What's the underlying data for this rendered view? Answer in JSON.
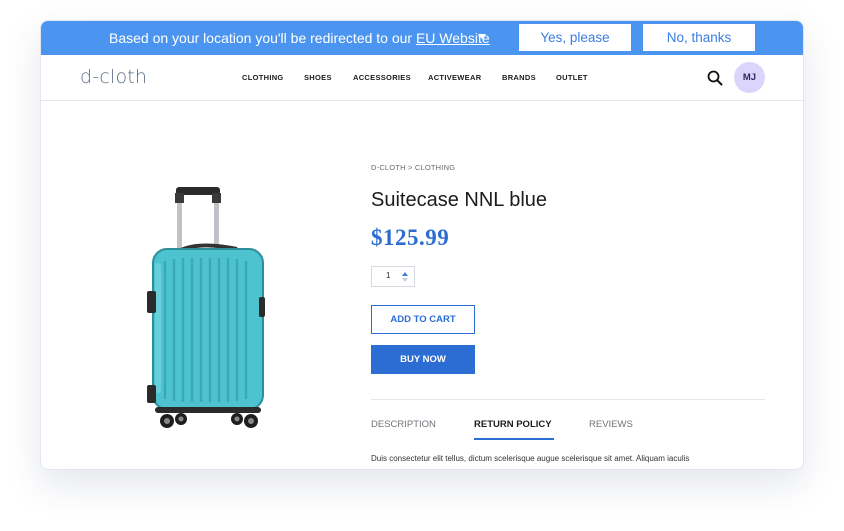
{
  "banner": {
    "text_prefix": "Based on your location you'll be redirected to our ",
    "link_text": "EU Website",
    "yes_label": "Yes, please",
    "no_label": "No, thanks"
  },
  "header": {
    "logo": "d-cloth",
    "nav": [
      "CLOTHING",
      "SHOES",
      "ACCESSORIES",
      "ACTIVEWEAR",
      "BRANDS",
      "OUTLET"
    ],
    "search_icon": "search-icon",
    "avatar_initials": "MJ"
  },
  "product": {
    "breadcrumb": "D-CLOTH > CLOTHING",
    "title": "Suitecase NNL blue",
    "price": "$125.99",
    "quantity": "1",
    "add_to_cart_label": "ADD TO CART",
    "buy_now_label": "BUY NOW",
    "image_icon": "suitcase-image"
  },
  "tabs": {
    "items": [
      "DESCRIPTION",
      "RETURN POLICY",
      "REVIEWS"
    ],
    "active": "RETURN POLICY",
    "content": "Duis consectetur elit tellus, dictum scelerisque augue scelerisque sit amet. Aliquam iaculis"
  },
  "colors": {
    "banner": "#4b95f0",
    "accent": "#2b6dd2",
    "suitcase": "#4cc3cf",
    "avatar_bg": "#dcd5fb"
  }
}
